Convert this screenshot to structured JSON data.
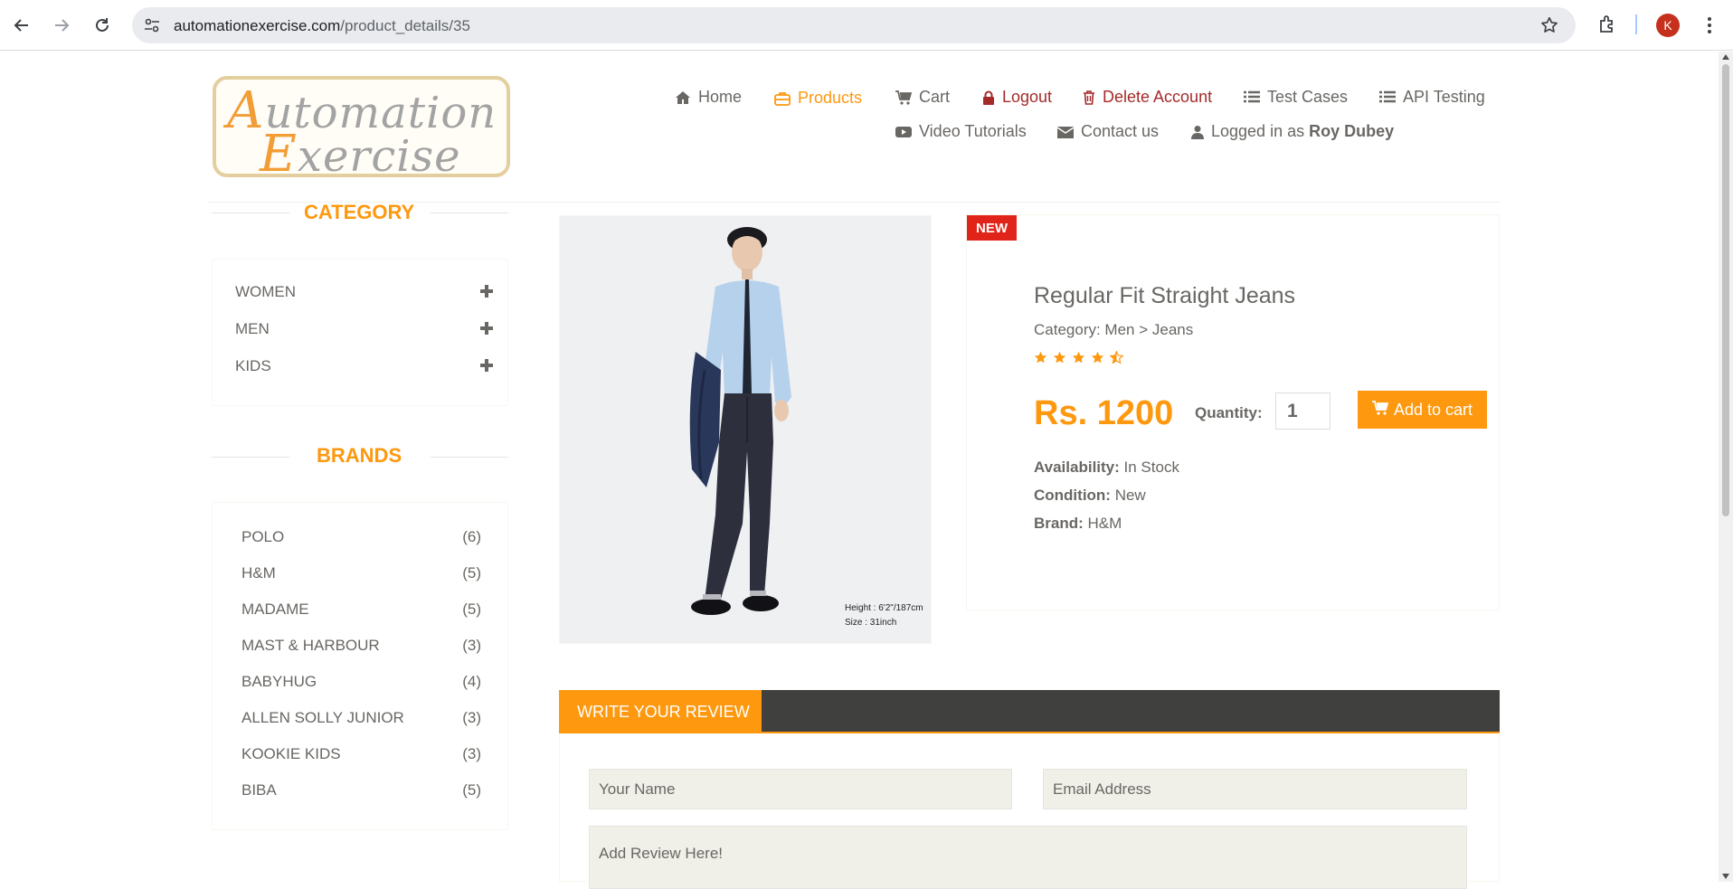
{
  "browser": {
    "url_domain": "automationexercise.com",
    "url_path": "/product_details/35",
    "profile_initial": "K"
  },
  "logo": {
    "line1_cap": "A",
    "line1_rest": "utomation",
    "line2_cap": "E",
    "line2_rest": "xercise"
  },
  "nav": {
    "home": "Home",
    "products": "Products",
    "cart": "Cart",
    "logout": "Logout",
    "delete_account": "Delete Account",
    "test_cases": "Test Cases",
    "api_testing": "API Testing",
    "video_tutorials": "Video Tutorials",
    "contact_us": "Contact us",
    "logged_in_prefix": "Logged in as",
    "logged_in_user": "Roy Dubey"
  },
  "sidebar": {
    "category_title": "CATEGORY",
    "categories": [
      "WOMEN",
      "MEN",
      "KIDS"
    ],
    "brands_title": "BRANDS",
    "brands": [
      {
        "name": "POLO",
        "count": "(6)"
      },
      {
        "name": "H&M",
        "count": "(5)"
      },
      {
        "name": "MADAME",
        "count": "(5)"
      },
      {
        "name": "MAST & HARBOUR",
        "count": "(3)"
      },
      {
        "name": "BABYHUG",
        "count": "(4)"
      },
      {
        "name": "ALLEN SOLLY JUNIOR",
        "count": "(3)"
      },
      {
        "name": "KOOKIE KIDS",
        "count": "(3)"
      },
      {
        "name": "BIBA",
        "count": "(5)"
      }
    ]
  },
  "product": {
    "badge": "NEW",
    "name": "Regular Fit Straight Jeans",
    "category": "Category: Men > Jeans",
    "rating": 4.5,
    "price": "Rs. 1200",
    "quantity_label": "Quantity:",
    "quantity_value": "1",
    "add_to_cart": "Add to cart",
    "availability_label": "Availability:",
    "availability_value": "In Stock",
    "condition_label": "Condition:",
    "condition_value": "New",
    "brand_label": "Brand:",
    "brand_value": "H&M",
    "image_caption_1": "Height : 6'2\"/187cm",
    "image_caption_2": "Size : 31inch"
  },
  "review": {
    "tab_label": "WRITE YOUR REVIEW",
    "name_placeholder": "Your Name",
    "email_placeholder": "Email Address",
    "review_placeholder": "Add Review Here!"
  },
  "colors": {
    "accent": "#fe980f",
    "text": "#696763",
    "danger": "#a52a2a",
    "badge": "#e12419"
  }
}
